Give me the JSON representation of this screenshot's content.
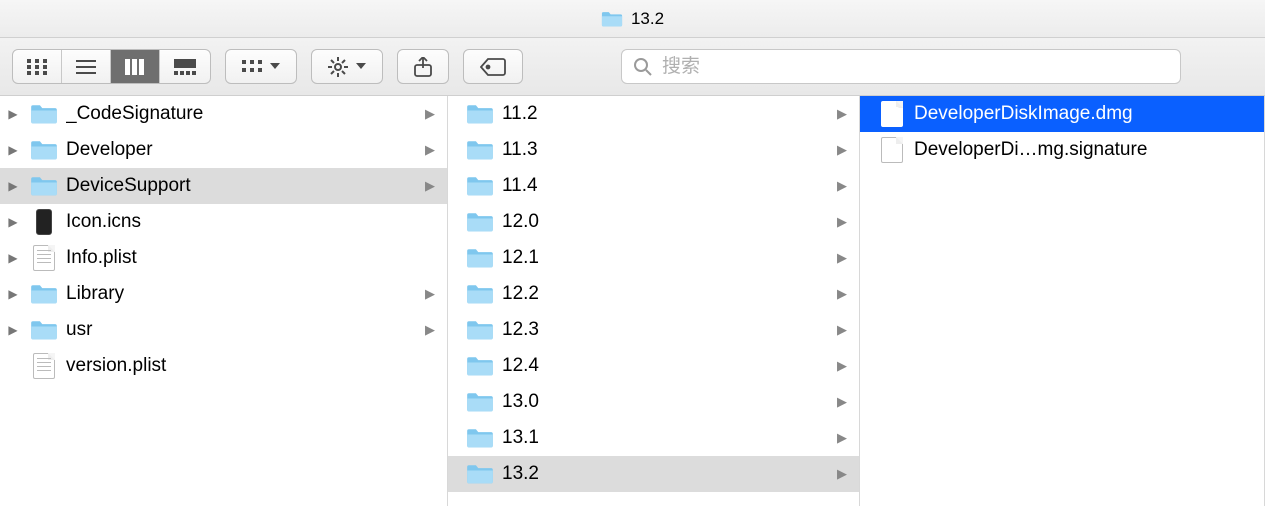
{
  "window": {
    "title": "13.2"
  },
  "search": {
    "placeholder": "搜索"
  },
  "col1": {
    "items": [
      {
        "label": "_CodeSignature",
        "icon": "folder",
        "hasChildren": true,
        "disclosure": true
      },
      {
        "label": "Developer",
        "icon": "folder",
        "hasChildren": true,
        "disclosure": true
      },
      {
        "label": "DeviceSupport",
        "icon": "folder",
        "hasChildren": true,
        "disclosure": true,
        "selected": true
      },
      {
        "label": "Icon.icns",
        "icon": "icns",
        "hasChildren": false,
        "disclosure": true
      },
      {
        "label": "Info.plist",
        "icon": "plist",
        "hasChildren": false,
        "disclosure": true
      },
      {
        "label": "Library",
        "icon": "folder",
        "hasChildren": true,
        "disclosure": true
      },
      {
        "label": "usr",
        "icon": "folder",
        "hasChildren": true,
        "disclosure": true
      },
      {
        "label": "version.plist",
        "icon": "plist",
        "hasChildren": false,
        "disclosure": false
      }
    ]
  },
  "col2": {
    "items": [
      {
        "label": "11.2",
        "icon": "folder",
        "hasChildren": true
      },
      {
        "label": "11.3",
        "icon": "folder",
        "hasChildren": true
      },
      {
        "label": "11.4",
        "icon": "folder",
        "hasChildren": true
      },
      {
        "label": "12.0",
        "icon": "folder",
        "hasChildren": true
      },
      {
        "label": "12.1",
        "icon": "folder",
        "hasChildren": true
      },
      {
        "label": "12.2",
        "icon": "folder",
        "hasChildren": true
      },
      {
        "label": "12.3",
        "icon": "folder",
        "hasChildren": true
      },
      {
        "label": "12.4",
        "icon": "folder",
        "hasChildren": true
      },
      {
        "label": "13.0",
        "icon": "folder",
        "hasChildren": true
      },
      {
        "label": "13.1",
        "icon": "folder",
        "hasChildren": true
      },
      {
        "label": "13.2",
        "icon": "folder",
        "hasChildren": true,
        "selected": true
      }
    ]
  },
  "col3": {
    "items": [
      {
        "label": "DeveloperDiskImage.dmg",
        "icon": "dmg",
        "selectedActive": true
      },
      {
        "label": "DeveloperDi…mg.signature",
        "icon": "file"
      }
    ]
  }
}
